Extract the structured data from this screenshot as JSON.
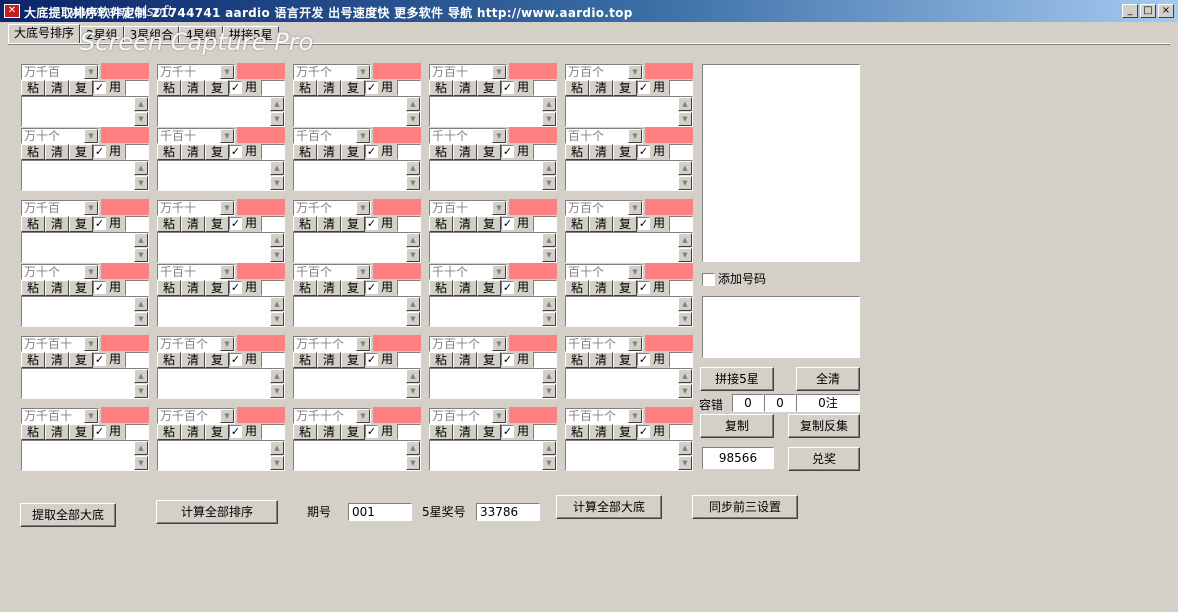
{
  "window": {
    "title": "大底提取排序软件定制 21744741  aardio 语言开发  出号速度快  更多软件  导航  http://www.aardio.top",
    "icon_text": "✕"
  },
  "watermark": {
    "url": "www.aapolsoft",
    "text": "Screen Capture Pro"
  },
  "tabs": [
    "大底号排序",
    "2星组",
    "3星组合",
    "4星组",
    "拼接5星"
  ],
  "cell_labels": {
    "paste": "粘",
    "clear": "清",
    "copy": "复",
    "use": "用",
    "checkmark": "✓"
  },
  "grid": [
    [
      "万千百",
      "万千十",
      "万千个",
      "万百十",
      "万百个"
    ],
    [
      "万十个",
      "千百十",
      "千百个",
      "千十个",
      "百十个"
    ],
    [
      "万千百",
      "万千十",
      "万千个",
      "万百十",
      "万百个"
    ],
    [
      "万十个",
      "千百十",
      "千百个",
      "千十个",
      "百十个"
    ],
    [
      "万千百十",
      "万千百个",
      "万千十个",
      "万百十个",
      "千百十个"
    ],
    [
      "万千百十",
      "万千百个",
      "万千十个",
      "万百十个",
      "千百十个"
    ]
  ],
  "right_panel": {
    "add_number_label": "添加号码",
    "concat_button": "拼接5星",
    "clear_all_button": "全清",
    "tolerance_label": "容错",
    "tolerance_min": "0",
    "tolerance_max": "0",
    "count_value": "0注",
    "copy_button": "复制",
    "copy_inverse_button": "复制反集",
    "prize_number": "98566",
    "redeem_button": "兑奖"
  },
  "bottom": {
    "extract_all_button": "提取全部大底",
    "calc_all_sort_button": "计算全部排序",
    "period_label": "期号",
    "period_value": "001",
    "prize5_label": "5星奖号",
    "prize5_value": "33786",
    "calc_all_base_button": "计算全部大底",
    "sync_top3_button": "同步前三设置"
  }
}
